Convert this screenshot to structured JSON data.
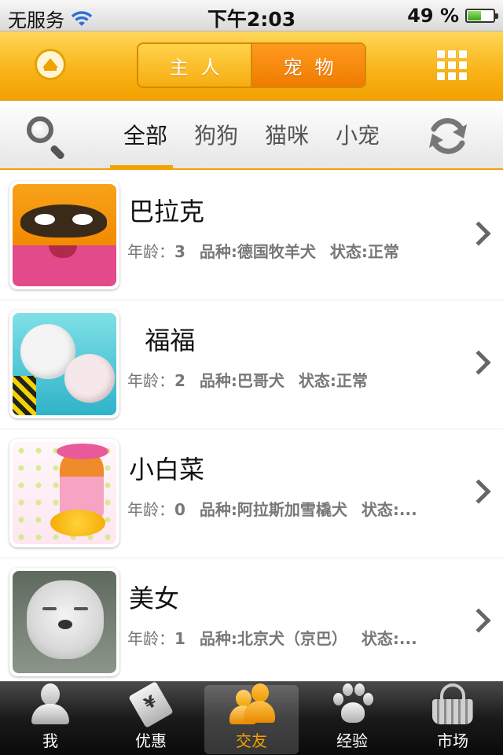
{
  "status_bar": {
    "carrier": "无服务",
    "time": "下午2:03",
    "battery_percent": "49 %",
    "battery_level": 0.49
  },
  "header": {
    "home_icon": "home-up-icon",
    "segments": [
      {
        "label": "主人",
        "selected": false
      },
      {
        "label": "宠物",
        "selected": true
      }
    ],
    "menu_icon": "grid-menu-icon",
    "colors": {
      "orange": "#f9b51a",
      "active_segment": "#ef7c00"
    }
  },
  "filter": {
    "search_icon": "search-icon",
    "refresh_icon": "refresh-icon",
    "tabs": [
      {
        "label": "全部",
        "active": true
      },
      {
        "label": "狗狗",
        "active": false
      },
      {
        "label": "猫咪",
        "active": false
      },
      {
        "label": "小宠",
        "active": false
      }
    ]
  },
  "pets": [
    {
      "name": "巴拉克",
      "age_label": "年龄：",
      "age": "3",
      "breed": "品种:德国牧羊犬",
      "status": "状态:正常"
    },
    {
      "name": "  福福",
      "age_label": "年龄：",
      "age": "2",
      "breed": "品种:巴哥犬",
      "status": "状态:正常"
    },
    {
      "name": "小白菜",
      "age_label": "年龄：",
      "age": "0",
      "breed": "品种:阿拉斯加雪橇犬",
      "status": "状态:..."
    },
    {
      "name": "美女",
      "age_label": "年龄：",
      "age": "1",
      "breed": "品种:北京犬（京巴）",
      "status": "状态:..."
    }
  ],
  "tabbar": {
    "items": [
      {
        "label": "我",
        "icon": "person-icon",
        "active": false
      },
      {
        "label": "优惠",
        "icon": "price-tag-icon",
        "active": false
      },
      {
        "label": "交友",
        "icon": "friends-icon",
        "active": true
      },
      {
        "label": "经验",
        "icon": "paw-icon",
        "active": false
      },
      {
        "label": "市场",
        "icon": "basket-icon",
        "active": false
      }
    ],
    "active_color": "#f4a000"
  }
}
